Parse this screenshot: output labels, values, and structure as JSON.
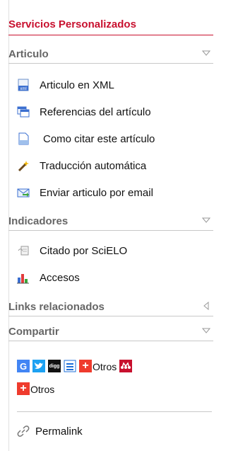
{
  "title": "Servicios Personalizados",
  "articulo": {
    "header": "Articulo",
    "items": [
      {
        "label": "Articulo en XML",
        "icon": "xml-document-icon"
      },
      {
        "label": "Referencias del artículo",
        "icon": "windows-icon"
      },
      {
        "label": "Como citar este artículo",
        "icon": "document-icon"
      },
      {
        "label": "Traducción automática",
        "icon": "magic-wand-icon"
      },
      {
        "label": "Enviar articulo por email",
        "icon": "email-icon"
      }
    ]
  },
  "indicadores": {
    "header": "Indicadores",
    "items": [
      {
        "label": "Citado por SciELO",
        "icon": "citation-icon"
      },
      {
        "label": "Accesos",
        "icon": "bar-chart-icon"
      }
    ]
  },
  "links": {
    "header": "Links relacionados"
  },
  "compartir": {
    "header": "Compartir",
    "buttons": [
      {
        "glyph": "G",
        "icon": "google-icon",
        "color": "#4285f4"
      },
      {
        "glyph": "",
        "icon": "twitter-icon",
        "color": "#1da1f2"
      },
      {
        "glyph": "digg",
        "icon": "digg-icon",
        "color": "#111111"
      },
      {
        "glyph": "",
        "icon": "list-icon",
        "color": "#1e6fd9"
      },
      {
        "glyph": "+",
        "icon": "plus-icon",
        "color": "#ef3b2d"
      }
    ],
    "otros_label": "Otros",
    "otros2_label": "Otros",
    "plus_color": "#ef3b2d",
    "mendeley_color": "#c8102e"
  },
  "permalink": "Permalink",
  "colors": {
    "accent": "#c8102e",
    "section": "#666666"
  }
}
